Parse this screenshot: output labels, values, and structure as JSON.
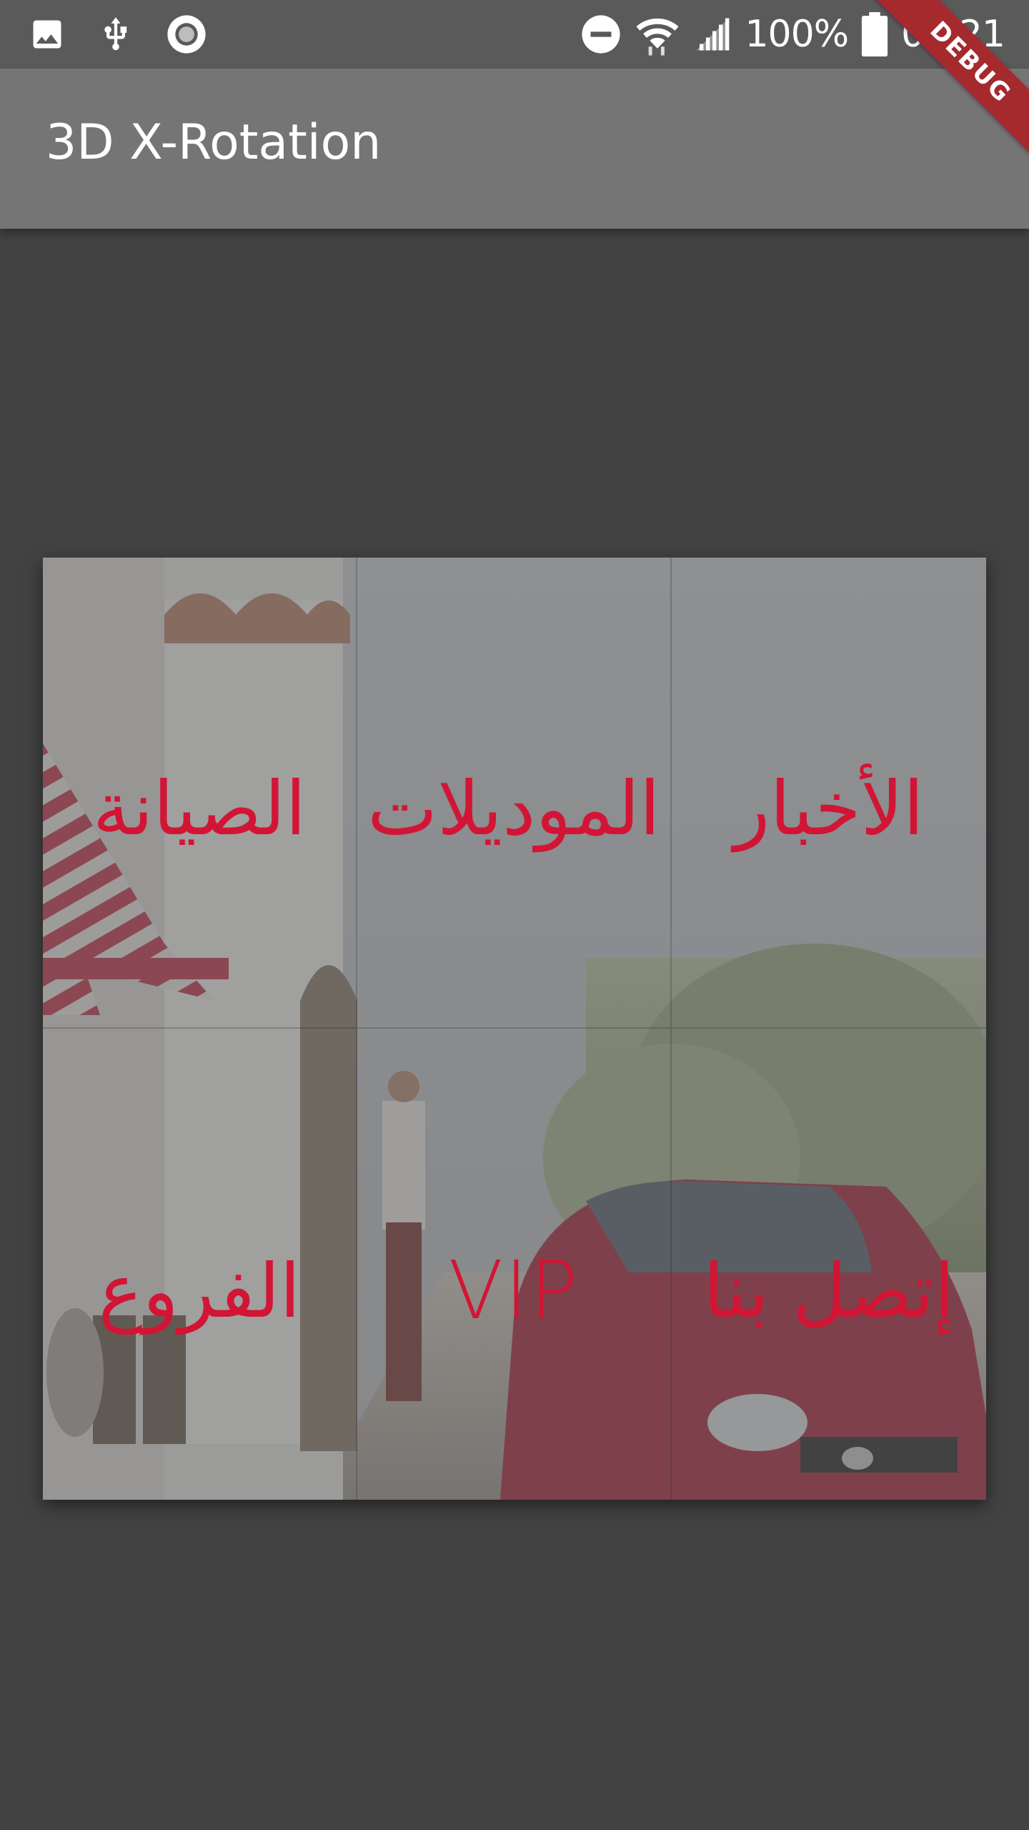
{
  "status_bar": {
    "icons_left": [
      "image-icon",
      "usb-icon",
      "record-icon"
    ],
    "icons_right": [
      "do-not-disturb-icon",
      "wifi-icon",
      "signal-icon",
      "battery-icon"
    ],
    "battery": "100%",
    "time": "01:21"
  },
  "app_bar": {
    "title": "3D X-Rotation"
  },
  "debug_banner": "DEBUG",
  "menu": {
    "items": [
      {
        "label": "الصيانة"
      },
      {
        "label": "الموديلات"
      },
      {
        "label": "الأخبار"
      },
      {
        "label": "الفروع"
      },
      {
        "label": "VIP"
      },
      {
        "label": "إتصل بنا"
      }
    ]
  },
  "colors": {
    "background": "#424242",
    "status_bar": "#5a5a5a",
    "app_bar": "#757575",
    "menu_text": "#d21535",
    "debug_banner": "#a52a2e"
  }
}
